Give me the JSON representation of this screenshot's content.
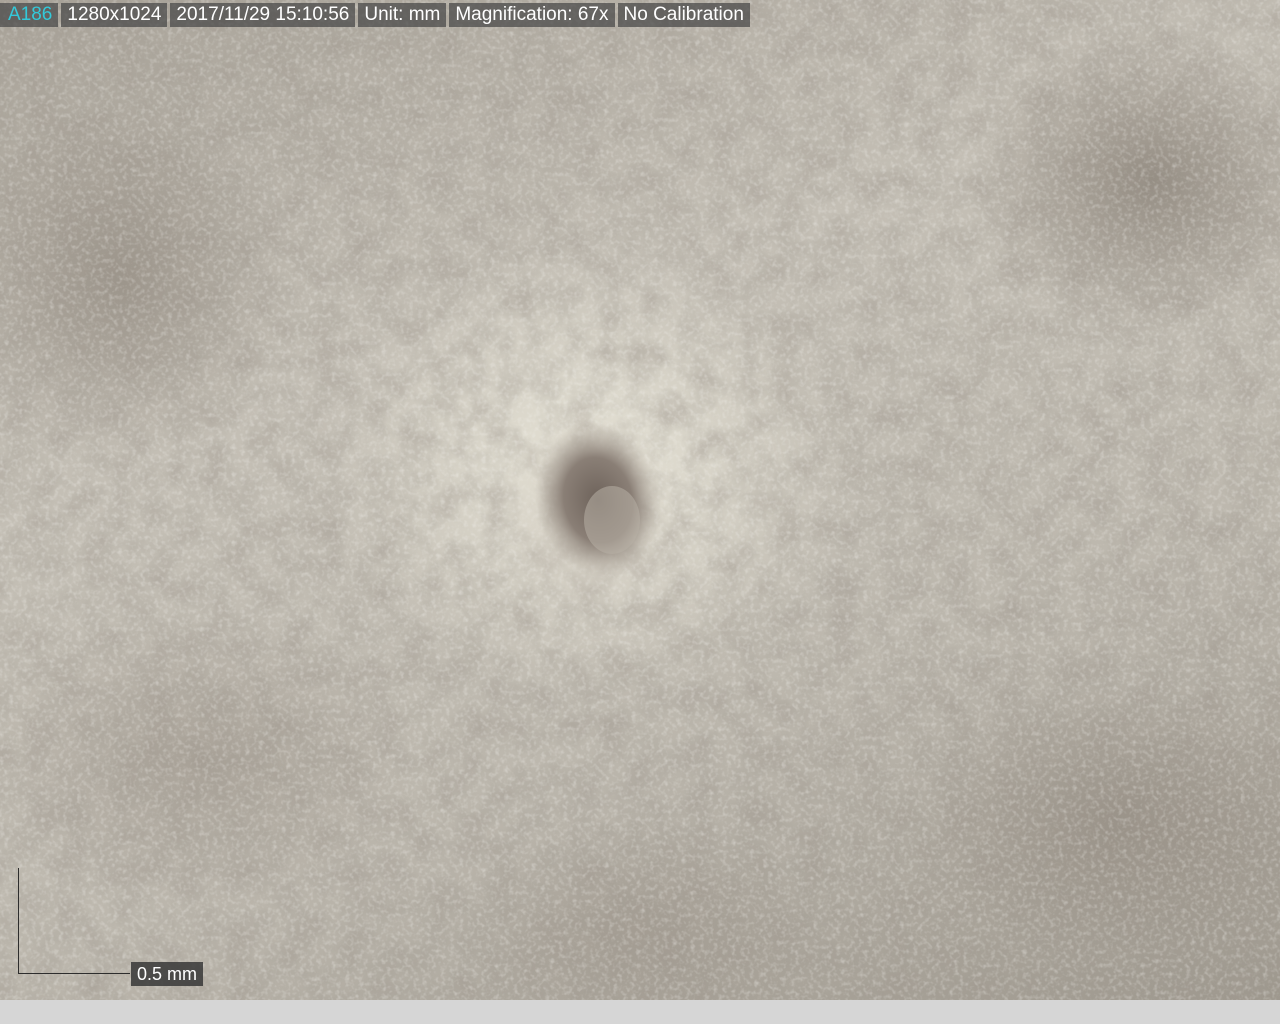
{
  "info_bar": {
    "image_id": "A186",
    "resolution": "1280x1024",
    "datetime": "2017/11/29 15:10:56",
    "unit": "Unit: mm",
    "magnification": "Magnification:  67x",
    "calibration": "No Calibration"
  },
  "scale_bar": {
    "label": "0.5 mm"
  },
  "colors": {
    "id_text": "#33c9d9",
    "overlay_bg": "#464646",
    "status_strip": "#d6d6d6"
  }
}
